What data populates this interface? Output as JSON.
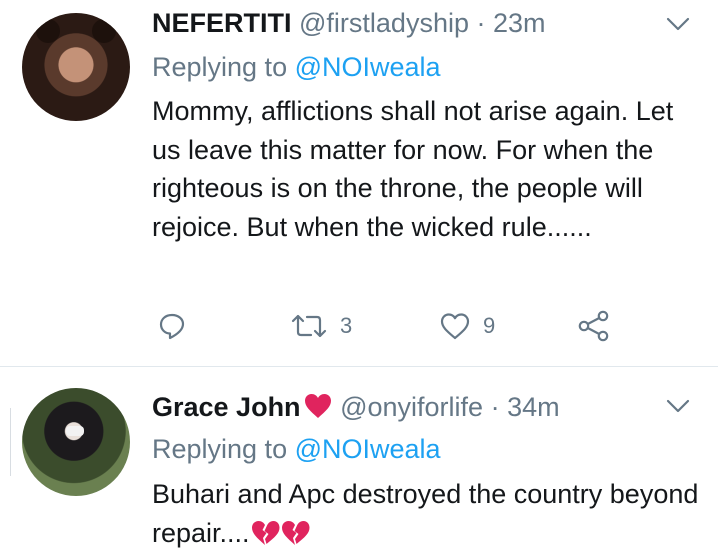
{
  "tweets": [
    {
      "name": "NEFERTITI",
      "handle": "@firstladyship",
      "separator": "·",
      "time": "23m",
      "replying_prefix": "Replying to",
      "replying_to": "@NOIweala",
      "text": "Mommy, afflictions shall not arise again. Let us leave this matter for now. For when the righteous is on the throne, the people will rejoice. But when the wicked rule......",
      "retweet_count": "3",
      "like_count": "9"
    },
    {
      "name": "Grace John",
      "name_emoji": "heart",
      "handle": "@onyiforlife",
      "separator": "·",
      "time": "34m",
      "replying_prefix": "Replying to",
      "replying_to": "@NOIweala",
      "text": "Buhari and Apc destroyed the country beyond repair....",
      "text_emojis": [
        "broken-heart",
        "broken-heart"
      ]
    }
  ],
  "colors": {
    "secondary_text": "#657786",
    "mention": "#1da1f2",
    "heart": "#e0245e",
    "divider": "#e1e8ed"
  },
  "icons": [
    "chevron-down-icon",
    "reply-icon",
    "retweet-icon",
    "like-icon",
    "share-icon"
  ]
}
